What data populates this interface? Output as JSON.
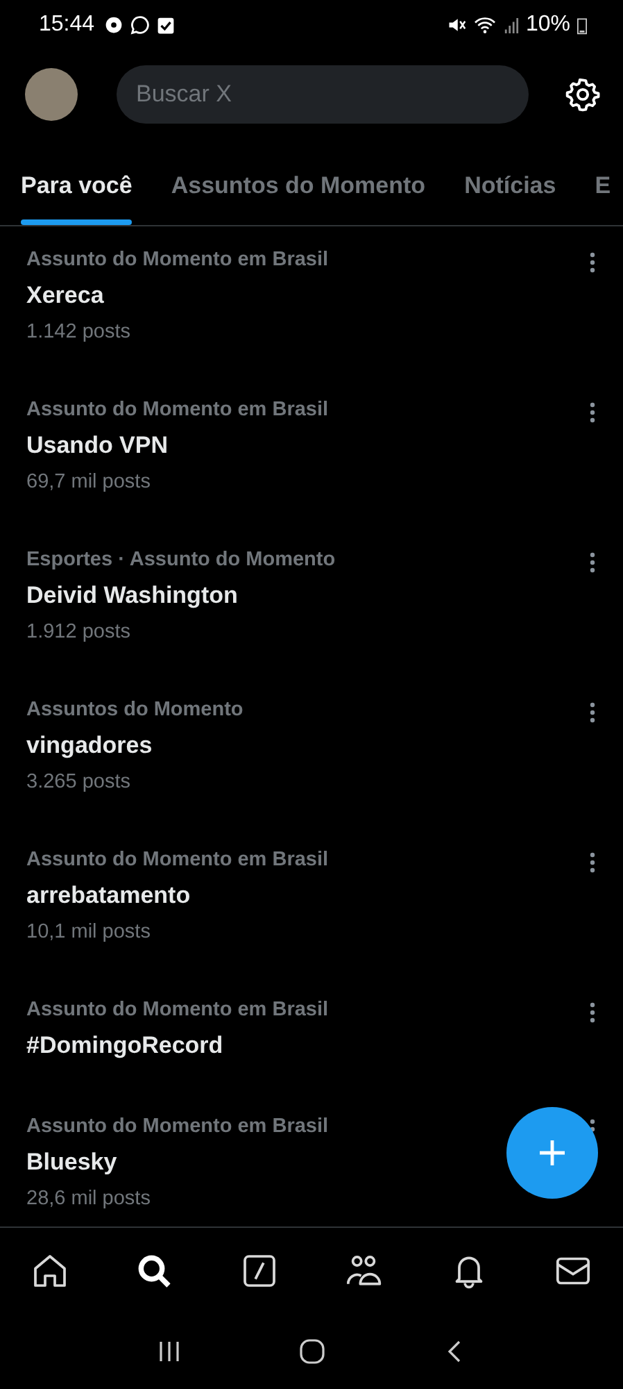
{
  "status_bar": {
    "time": "15:44",
    "battery": "10%"
  },
  "search": {
    "placeholder": "Buscar X"
  },
  "tabs": [
    {
      "label": "Para você",
      "selected": true
    },
    {
      "label": "Assuntos do Momento",
      "selected": false
    },
    {
      "label": "Notícias",
      "selected": false
    },
    {
      "label": "E",
      "selected": false
    }
  ],
  "trends": [
    {
      "context": "Assunto do Momento em Brasil",
      "topic": "Xereca",
      "posts": "1.142 posts"
    },
    {
      "context": "Assunto do Momento em Brasil",
      "topic": "Usando VPN",
      "posts": "69,7 mil posts"
    },
    {
      "context": "Esportes · Assunto do Momento",
      "topic": "Deivid Washington",
      "posts": "1.912 posts"
    },
    {
      "context": "Assuntos do Momento",
      "topic": "vingadores",
      "posts": "3.265 posts"
    },
    {
      "context": "Assunto do Momento em Brasil",
      "topic": "arrebatamento",
      "posts": "10,1 mil posts"
    },
    {
      "context": "Assunto do Momento em Brasil",
      "topic": "#DomingoRecord"
    },
    {
      "context": "Assunto do Momento em Brasil",
      "topic": "Bluesky",
      "posts": "28,6 mil posts"
    }
  ],
  "bottom_nav": [
    {
      "kind": "home",
      "selected": false
    },
    {
      "kind": "search",
      "selected": true
    },
    {
      "kind": "grok",
      "selected": false
    },
    {
      "kind": "communities",
      "selected": false
    },
    {
      "kind": "notifications",
      "selected": false
    },
    {
      "kind": "messages",
      "selected": false
    }
  ]
}
